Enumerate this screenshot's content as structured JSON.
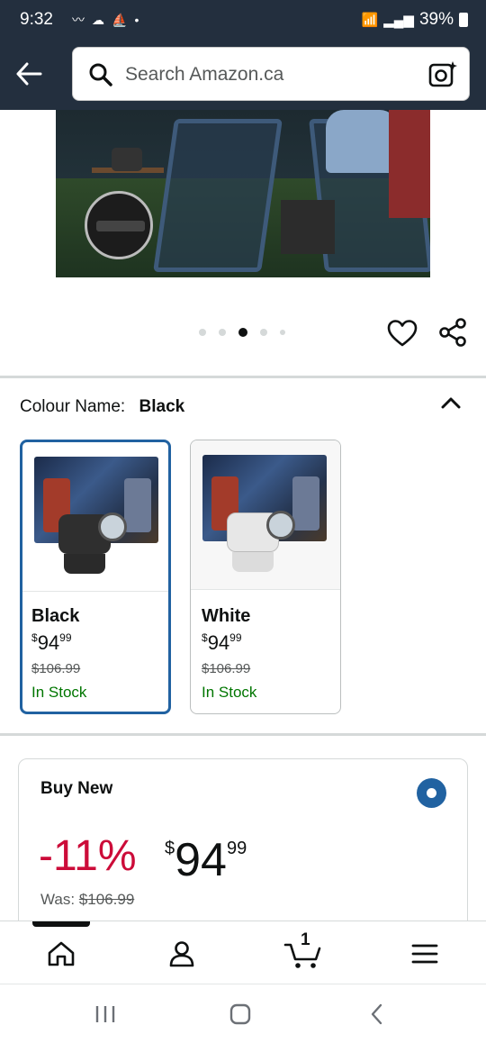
{
  "status_bar": {
    "time": "9:32",
    "battery": "39%"
  },
  "search": {
    "placeholder": "Search Amazon.ca"
  },
  "carousel": {
    "count": 5,
    "active_index": 2
  },
  "colour_selector": {
    "label": "Colour Name:",
    "selected": "Black"
  },
  "variants": [
    {
      "name": "Black",
      "price_dollar": "$",
      "price_whole": "94",
      "price_cents": "99",
      "was": "$106.99",
      "stock": "In Stock",
      "selected": true
    },
    {
      "name": "White",
      "price_dollar": "$",
      "price_whole": "94",
      "price_cents": "99",
      "was": "$106.99",
      "stock": "In Stock",
      "selected": false
    }
  ],
  "buy_new": {
    "title": "Buy New",
    "discount": "-11%",
    "currency": "$",
    "price_whole": "94",
    "price_cents": "99",
    "was_label": "Was:",
    "was_price": "$106.99"
  },
  "bottom_nav": {
    "cart_count": "1"
  },
  "colors": {
    "header_bg": "#232f3e",
    "selected_border": "#2162a1",
    "discount": "#cc0c39",
    "in_stock": "#007600"
  }
}
